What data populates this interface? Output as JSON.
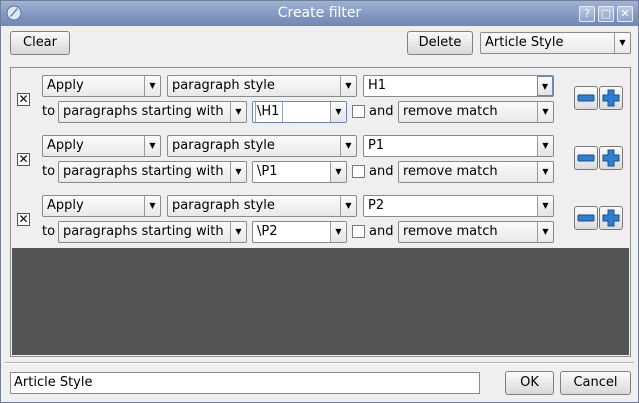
{
  "window": {
    "title": "Create filter",
    "help_label": "?",
    "maximize_label": "□",
    "close_label": "✕"
  },
  "toolbar": {
    "clear_label": "Clear",
    "delete_label": "Delete",
    "preset_selected": "Article Style"
  },
  "rows": [
    {
      "enabled": true,
      "action": "Apply",
      "target": "paragraph style",
      "style_value": "H1",
      "to_label": "to",
      "condition": "paragraphs starting with",
      "match_value": "\\H1",
      "and_checked": false,
      "and_label": "and",
      "post_action": "remove match"
    },
    {
      "enabled": true,
      "action": "Apply",
      "target": "paragraph style",
      "style_value": "P1",
      "to_label": "to",
      "condition": "paragraphs starting with",
      "match_value": "\\P1",
      "and_checked": false,
      "and_label": "and",
      "post_action": "remove match"
    },
    {
      "enabled": true,
      "action": "Apply",
      "target": "paragraph style",
      "style_value": "P2",
      "to_label": "to",
      "condition": "paragraphs starting with",
      "match_value": "\\P2",
      "and_checked": false,
      "and_label": "and",
      "post_action": "remove match"
    }
  ],
  "footer": {
    "name_value": "Article Style",
    "ok_label": "OK",
    "cancel_label": "Cancel"
  },
  "icons": {
    "remove_row": "minus-icon",
    "add_row": "plus-icon",
    "app": "app-logo-icon"
  },
  "colors": {
    "titlebar": "#8399c3",
    "empty_area": "#525552",
    "icon_blue": "#2f7fd0"
  }
}
